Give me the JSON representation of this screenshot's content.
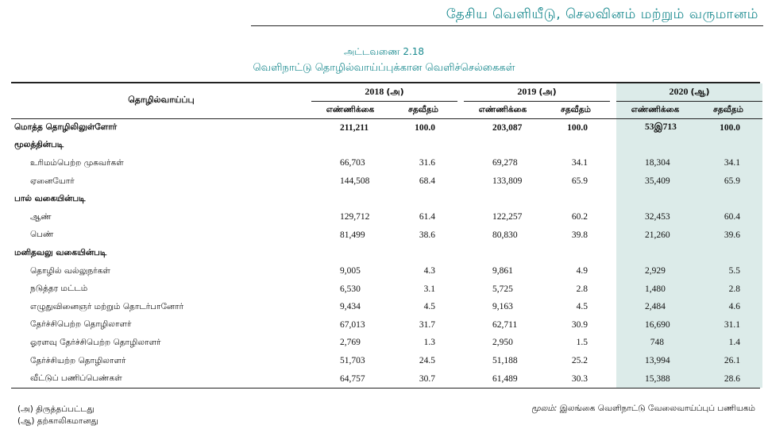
{
  "header": {
    "title": "தேசிய வெளியீடு, செலவினம் மற்றும் வருமானம்"
  },
  "table": {
    "number": "அட்டவணை 2.18",
    "title": "வெளிநாட்டு தொழில்வாய்ப்புக்கான வெளிச்செல்கைகள்",
    "label_header": "தொழில்வாய்ப்பு",
    "years": [
      {
        "year": "2018",
        "note": "(அ)"
      },
      {
        "year": "2019",
        "note": "(அ)"
      },
      {
        "year": "2020",
        "note": "(ஆ)"
      }
    ],
    "sub_headers": {
      "count": "எண்ணிக்கை",
      "percent": "சதவீதம்"
    },
    "rows": [
      {
        "kind": "total",
        "label": "மொத்த தொழிலிலுள்ளோர்",
        "values": [
          "211,211",
          "100.0",
          "203,087",
          "100.0",
          "53இ713",
          "100.0"
        ]
      },
      {
        "kind": "section",
        "label": "மூலத்தின்படி"
      },
      {
        "kind": "item",
        "label": "உரிமம்பெற்ற முகவர்கள்",
        "values": [
          "66,703",
          "31.6",
          "69,278",
          "34.1",
          "18,304",
          "34.1"
        ]
      },
      {
        "kind": "item",
        "label": "ஏனையோர்",
        "values": [
          "144,508",
          "68.4",
          "133,809",
          "65.9",
          "35,409",
          "65.9"
        ]
      },
      {
        "kind": "section",
        "label": "பால் வகையின்படி"
      },
      {
        "kind": "item",
        "label": "ஆண்",
        "values": [
          "129,712",
          "61.4",
          "122,257",
          "60.2",
          "32,453",
          "60.4"
        ]
      },
      {
        "kind": "item",
        "label": "பெண்",
        "values": [
          "81,499",
          "38.6",
          "80,830",
          "39.8",
          "21,260",
          "39.6"
        ]
      },
      {
        "kind": "section",
        "label": "மனிதவலு வகையின்படி"
      },
      {
        "kind": "item",
        "label": "தொழில் வல்லுநர்கள்",
        "values": [
          "9,005",
          "4.3",
          "9,861",
          "4.9",
          "2,929",
          "5.5"
        ]
      },
      {
        "kind": "item",
        "label": "நடுத்தர மட்டம்",
        "values": [
          "6,530",
          "3.1",
          "5,725",
          "2.8",
          "1,480",
          "2.8"
        ]
      },
      {
        "kind": "item",
        "label": "எழுதுவினைஞர் மற்றும் தொடர்பானோர்",
        "values": [
          "9,434",
          "4.5",
          "9,163",
          "4.5",
          "2,484",
          "4.6"
        ]
      },
      {
        "kind": "item",
        "label": "தேர்ச்சிபெற்ற தொழிலாளர்",
        "values": [
          "67,013",
          "31.7",
          "62,711",
          "30.9",
          "16,690",
          "31.1"
        ]
      },
      {
        "kind": "item",
        "label": "ஓரளவு தேர்ச்சிபெற்ற தொழிலாளர்",
        "values": [
          "2,769",
          "1.3",
          "2,950",
          "1.5",
          "748",
          "1.4"
        ]
      },
      {
        "kind": "item",
        "label": "தேர்ச்சியற்ற தொழிலாளர்",
        "values": [
          "51,703",
          "24.5",
          "51,188",
          "25.2",
          "13,994",
          "26.1"
        ]
      },
      {
        "kind": "item",
        "label": "வீட்டுப் பணிப்பெண்கள்",
        "values": [
          "64,757",
          "30.7",
          "61,489",
          "30.3",
          "15,388",
          "28.6"
        ]
      }
    ]
  },
  "footnotes": {
    "a": "(அ) திருத்தப்பட்டது",
    "b": "(ஆ) தற்காலிகமானது",
    "source_label": "மூலம்:",
    "source_text": "இலங்கை வெளிநாட்டு வேலைவாய்ப்புப் பணியகம்"
  },
  "colors": {
    "accent": "#1a8a8f",
    "shade": "#dcebe9"
  }
}
